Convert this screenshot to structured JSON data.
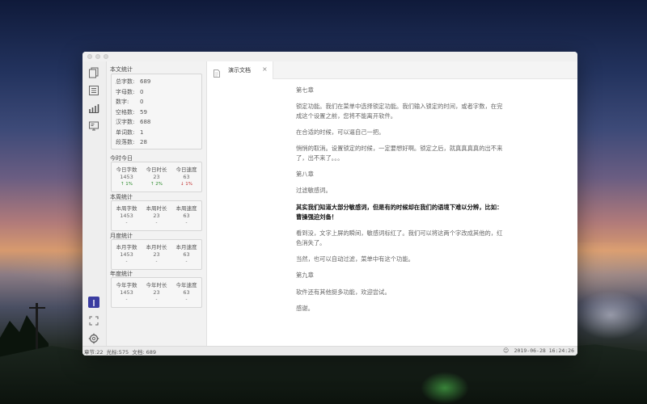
{
  "sidebar_icons": [
    "documents-icon",
    "list-icon",
    "stats-icon",
    "monitor-icon"
  ],
  "bottom_icons": [
    "app-badge-icon",
    "fullscreen-icon",
    "settings-icon"
  ],
  "stats": {
    "doc_title": "本文统计",
    "doc_rows": [
      {
        "k": "总字数:",
        "v": "689"
      },
      {
        "k": "字母数:",
        "v": "0"
      },
      {
        "k": "数字:",
        "v": "0"
      },
      {
        "k": "空格数:",
        "v": "59"
      },
      {
        "k": "汉字数:",
        "v": "688"
      },
      {
        "k": "单词数:",
        "v": "1"
      },
      {
        "k": "段落数:",
        "v": "28"
      }
    ],
    "today": {
      "title": "今时今日",
      "cells": [
        {
          "label": "今日字数",
          "value": "1453",
          "change": "↑ 1%",
          "dir": "up"
        },
        {
          "label": "今日时长",
          "value": "23",
          "change": "↑ 2%",
          "dir": "up"
        },
        {
          "label": "今日速度",
          "value": "63",
          "change": "↓ 1%",
          "dir": "down"
        }
      ]
    },
    "week": {
      "title": "本周统计",
      "cells": [
        {
          "label": "本周字数",
          "value": "1453",
          "change": "-"
        },
        {
          "label": "本周时长",
          "value": "23",
          "change": "-"
        },
        {
          "label": "本周速度",
          "value": "63",
          "change": "-"
        }
      ]
    },
    "month": {
      "title": "月度统计",
      "cells": [
        {
          "label": "本月字数",
          "value": "1453",
          "change": "-"
        },
        {
          "label": "本月时长",
          "value": "23",
          "change": "-"
        },
        {
          "label": "本月速度",
          "value": "63",
          "change": "-"
        }
      ]
    },
    "year": {
      "title": "年度统计",
      "cells": [
        {
          "label": "今年字数",
          "value": "1453",
          "change": "-"
        },
        {
          "label": "今年时长",
          "value": "23",
          "change": "-"
        },
        {
          "label": "今年速度",
          "value": "63",
          "change": "-"
        }
      ]
    }
  },
  "tab": {
    "label": "演示文档",
    "close": "×"
  },
  "editor": {
    "paragraphs": [
      {
        "text": "第七章",
        "bold": false
      },
      {
        "text": "锁定功能。我们在菜单中选择锁定功能。我们输入锁定的时间，或者字数，在完成这个设置之前，您将不能离开软件。",
        "bold": false
      },
      {
        "text": "在合适的时候，可以逼自己一把。",
        "bold": false
      },
      {
        "text": "悄悄的取消。设置锁定的时候，一定要想好啊。锁定之后，就真真真真的出不来了，出不来了。。。",
        "bold": false
      },
      {
        "text": "第八章",
        "bold": false
      },
      {
        "text": "过滤敏感词。",
        "bold": false
      },
      {
        "text": "其实我们知道大部分敏感词，但是有的时候却在我们的语境下难以分辨，比如：曹操强迫刘备！",
        "bold": true
      },
      {
        "text": "看到没，文字上屏的瞬间，敏感词标红了。我们可以将这两个字改成其他的，红色消失了。",
        "bold": false
      },
      {
        "text": "当然，也可以自动过滤，菜单中有这个功能。",
        "bold": false
      },
      {
        "text": "第九章",
        "bold": false
      },
      {
        "text": "软件还有其他挺多功能，欢迎尝试。",
        "bold": false
      },
      {
        "text": "感谢。",
        "bold": false
      }
    ]
  },
  "statusbar": {
    "left": "章节:22  光标:575  文档: 689",
    "smile": "☺",
    "datetime": "2019-06-28 16:24:26"
  }
}
